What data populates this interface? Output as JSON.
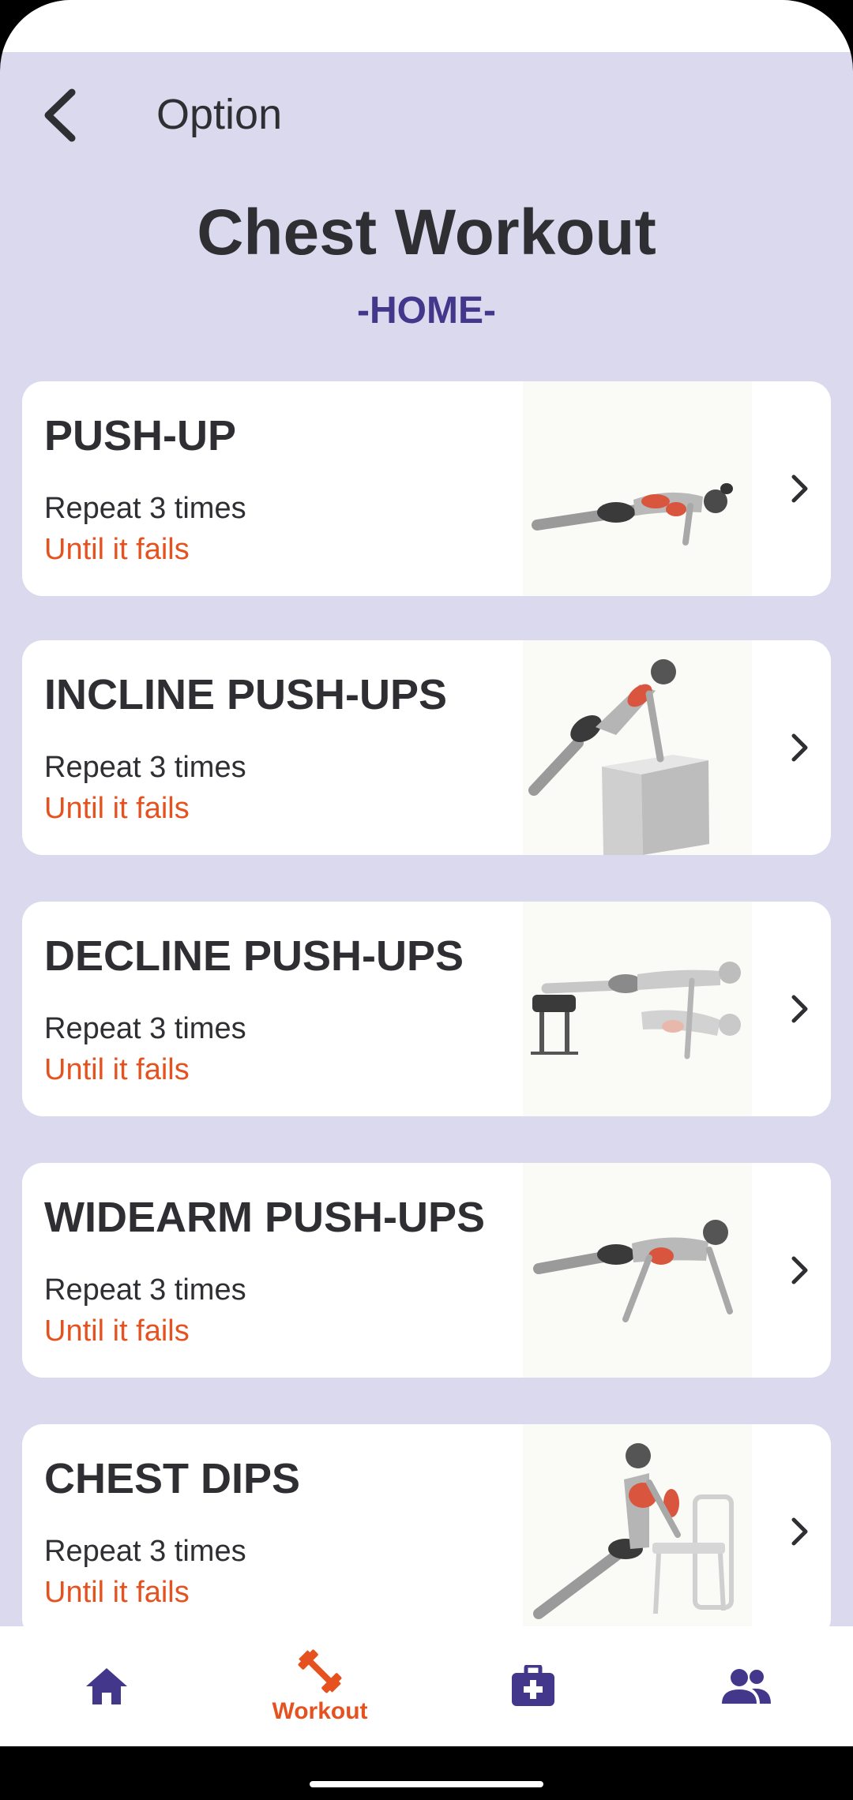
{
  "appbar": {
    "title": "Option",
    "back_icon": "chevron-left-icon"
  },
  "page": {
    "title": "Chest Workout",
    "subtitle": "-HOME-"
  },
  "exercises": [
    {
      "name": "PUSH-UP",
      "reps": "Repeat 3 times",
      "note": "Until it fails",
      "illustration": "push-up-illustration"
    },
    {
      "name": "INCLINE PUSH-UPS",
      "reps": "Repeat 3 times",
      "note": "Until it fails",
      "illustration": "incline-push-up-illustration"
    },
    {
      "name": "DECLINE PUSH-UPS",
      "reps": "Repeat 3 times",
      "note": "Until it fails",
      "illustration": "decline-push-up-illustration"
    },
    {
      "name": "WIDEARM PUSH-UPS",
      "reps": "Repeat 3 times",
      "note": "Until it fails",
      "illustration": "widearm-push-up-illustration"
    },
    {
      "name": "CHEST DIPS",
      "reps": "Repeat 3 times",
      "note": "Until it fails",
      "illustration": "chest-dips-illustration"
    }
  ],
  "bottom_nav": {
    "items": [
      {
        "icon": "home-icon",
        "label": "",
        "active": false
      },
      {
        "icon": "dumbbell-icon",
        "label": "Workout",
        "active": true
      },
      {
        "icon": "medical-kit-icon",
        "label": "",
        "active": false
      },
      {
        "icon": "people-icon",
        "label": "",
        "active": false
      }
    ]
  },
  "colors": {
    "background": "#dad9ee",
    "accent_purple": "#43378c",
    "accent_orange": "#e6521f",
    "text_dark": "#2f2f33",
    "muscle_red": "#d9553e"
  }
}
